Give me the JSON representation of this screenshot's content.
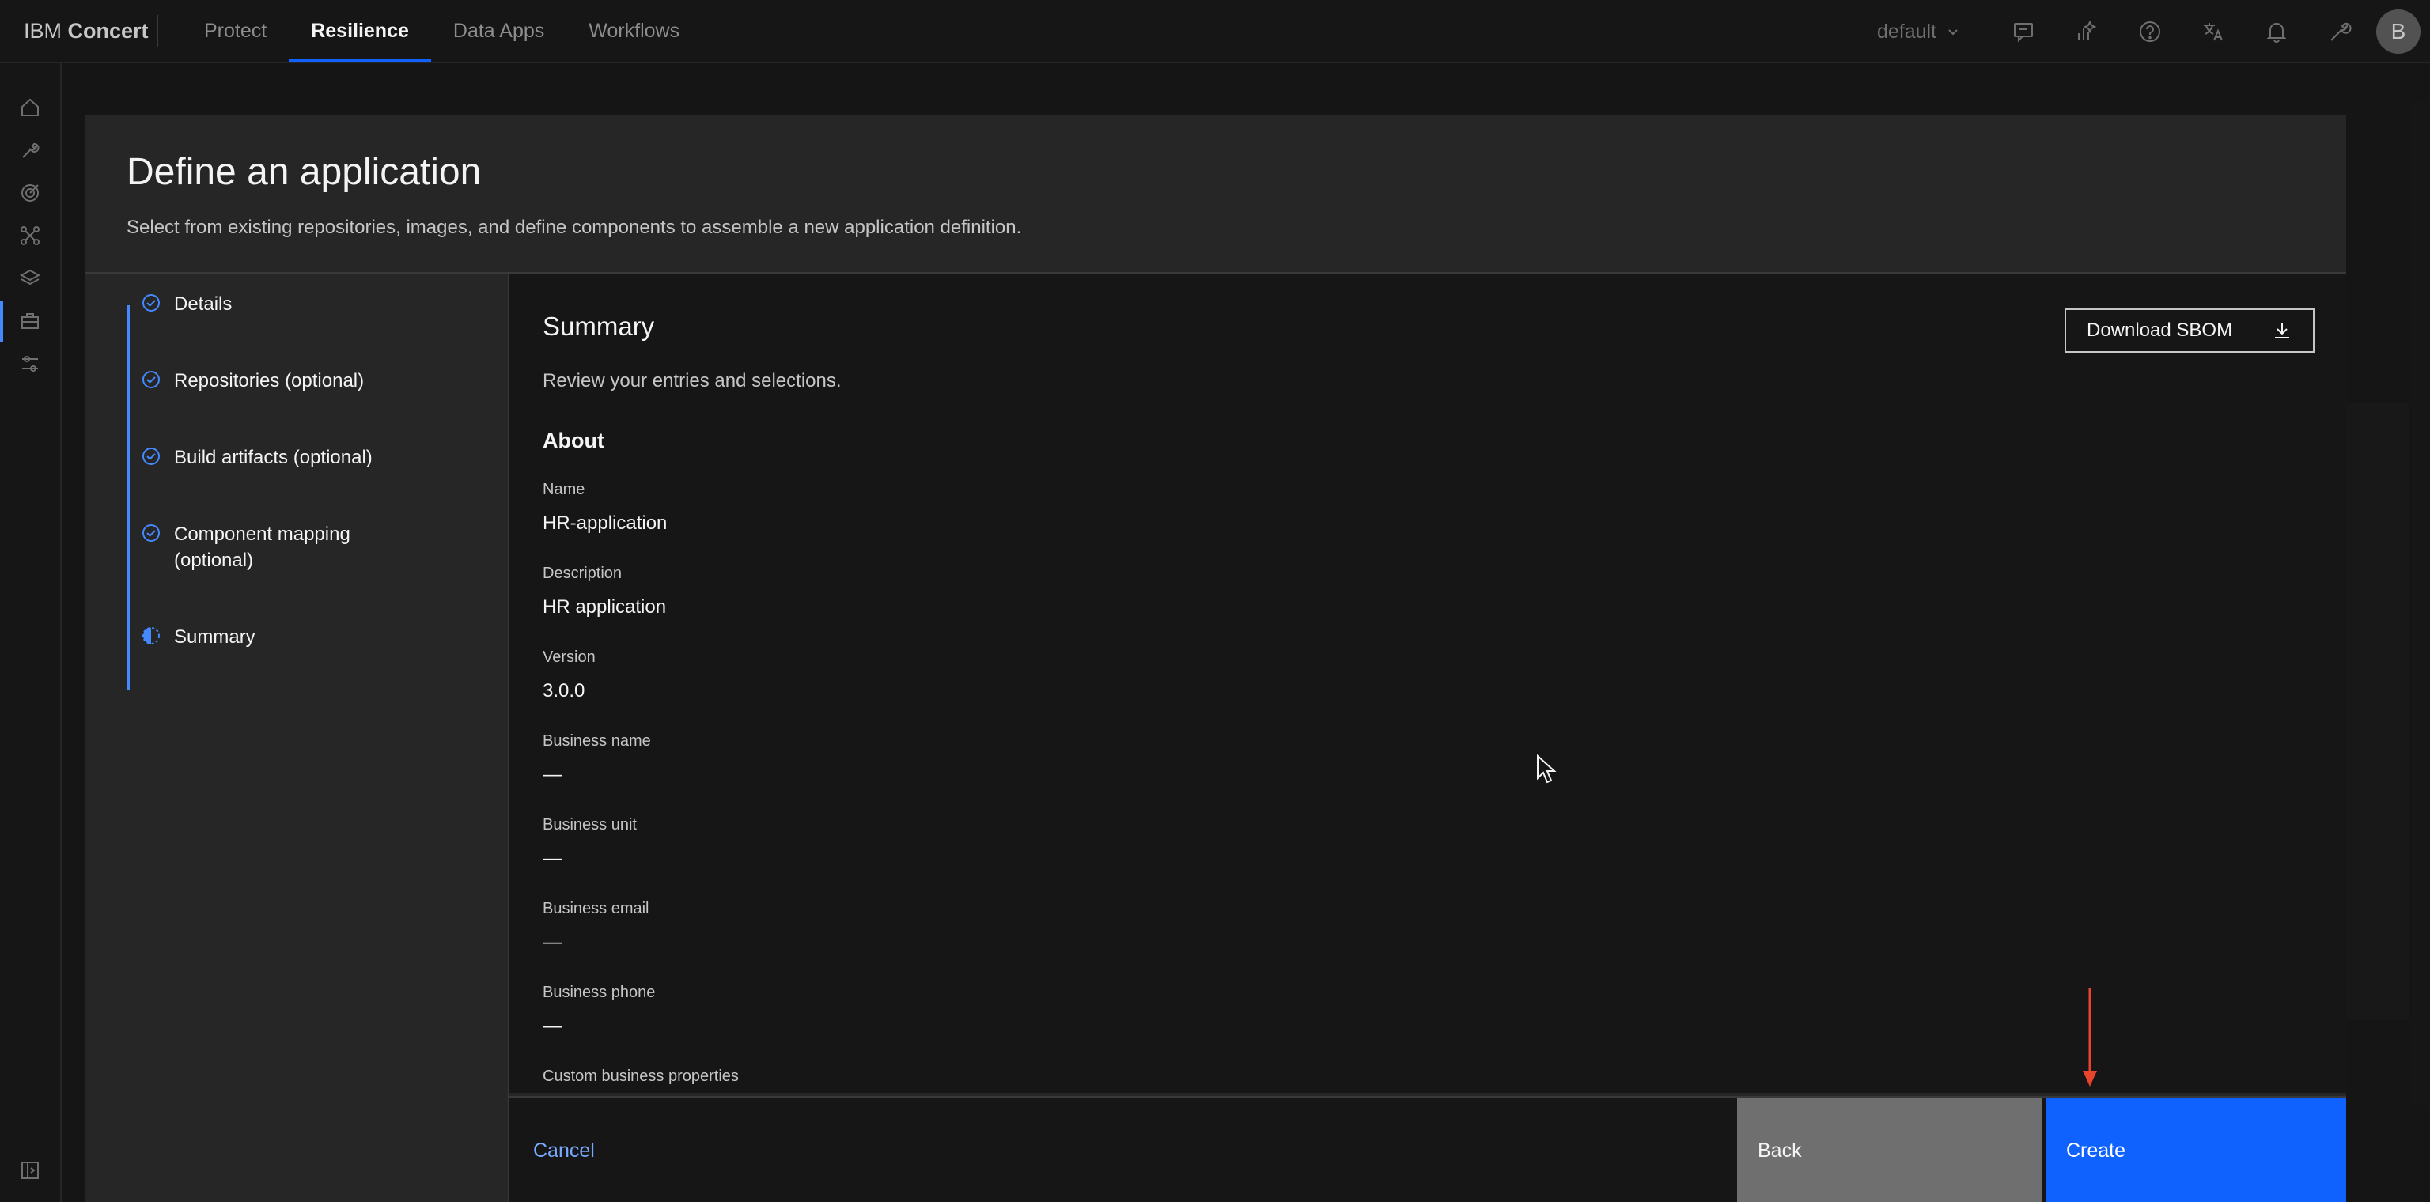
{
  "header": {
    "brand_prefix": "IBM",
    "brand_name": "Concert",
    "nav": [
      {
        "label": "Protect",
        "active": false
      },
      {
        "label": "Resilience",
        "active": true
      },
      {
        "label": "Data Apps",
        "active": false
      },
      {
        "label": "Workflows",
        "active": false
      }
    ],
    "tenant": "default",
    "icons": [
      "chat-icon",
      "ai-insights-icon",
      "help-icon",
      "translate-icon",
      "notification-icon",
      "settings-icon"
    ],
    "avatar_initial": "B"
  },
  "rail_icons": [
    "home-icon",
    "tools-icon",
    "target-icon",
    "network-icon",
    "layers-icon",
    "applications-icon",
    "sliders-icon",
    "expand-rail-icon"
  ],
  "modal": {
    "title": "Define an application",
    "subtitle": "Select from existing repositories, images, and define components to assemble a new application definition.",
    "steps": [
      {
        "label": "Details",
        "status": "complete"
      },
      {
        "label": "Repositories (optional)",
        "status": "complete"
      },
      {
        "label": "Build artifacts (optional)",
        "status": "complete"
      },
      {
        "label": "Component mapping (optional)",
        "status": "complete"
      },
      {
        "label": "Summary",
        "status": "current"
      }
    ],
    "summary": {
      "title": "Summary",
      "subtitle": "Review your entries and selections.",
      "download_label": "Download SBOM",
      "about_heading": "About",
      "fields": [
        {
          "label": "Name",
          "value": "HR-application"
        },
        {
          "label": "Description",
          "value": "HR application"
        },
        {
          "label": "Version",
          "value": "3.0.0"
        },
        {
          "label": "Business name",
          "value": "—"
        },
        {
          "label": "Business unit",
          "value": "—"
        },
        {
          "label": "Business email",
          "value": "—"
        },
        {
          "label": "Business phone",
          "value": "—"
        },
        {
          "label": "Custom business properties",
          "value": ""
        }
      ]
    },
    "footer": {
      "cancel_label": "Cancel",
      "back_label": "Back",
      "create_label": "Create"
    }
  },
  "colors": {
    "primary": "#0f62fe",
    "link": "#78a9ff",
    "step_accent": "#4589ff",
    "annotation_arrow": "#e8452c"
  }
}
